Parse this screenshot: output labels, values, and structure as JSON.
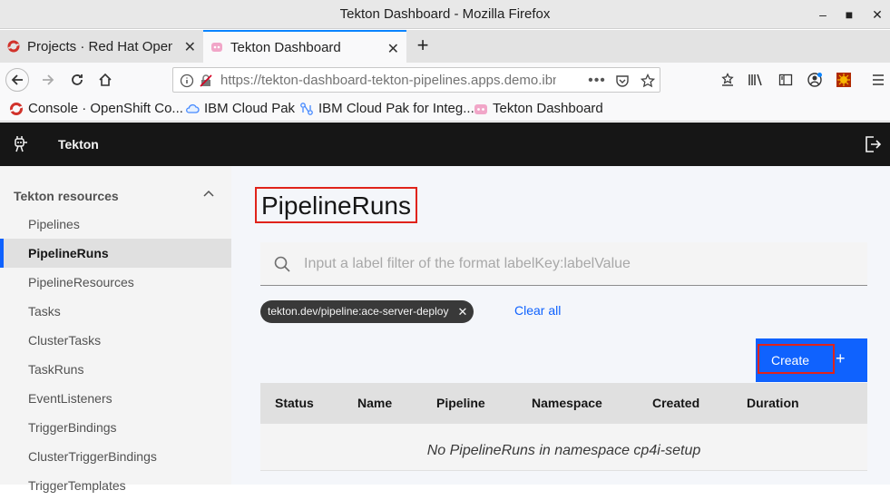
{
  "window": {
    "title": "Tekton Dashboard - Mozilla Firefox"
  },
  "tabs": [
    {
      "label": "Projects · Red Hat OpenS",
      "active": false
    },
    {
      "label": "Tekton Dashboard",
      "active": true
    }
  ],
  "address_bar": {
    "url": "https://tekton-dashboard-tekton-pipelines.apps.demo.ibm"
  },
  "bookmarks": [
    {
      "label": "Console · OpenShift Co..."
    },
    {
      "label": "IBM Cloud Pak"
    },
    {
      "label": "IBM Cloud Pak for Integ..."
    },
    {
      "label": "Tekton Dashboard"
    }
  ],
  "app": {
    "name": "Tekton"
  },
  "sidebar": {
    "section_title": "Tekton resources",
    "items": [
      {
        "label": "Pipelines"
      },
      {
        "label": "PipelineRuns",
        "active": true
      },
      {
        "label": "PipelineResources"
      },
      {
        "label": "Tasks"
      },
      {
        "label": "ClusterTasks"
      },
      {
        "label": "TaskRuns"
      },
      {
        "label": "EventListeners"
      },
      {
        "label": "TriggerBindings"
      },
      {
        "label": "ClusterTriggerBindings"
      },
      {
        "label": "TriggerTemplates"
      }
    ]
  },
  "main": {
    "title": "PipelineRuns",
    "filter_placeholder": "Input a label filter of the format labelKey:labelValue",
    "active_filter": "tekton.dev/pipeline:ace-server-deploy",
    "clear_all": "Clear all",
    "create_label": "Create",
    "table": {
      "columns": [
        "Status",
        "Name",
        "Pipeline",
        "Namespace",
        "Created",
        "Duration"
      ],
      "empty_message": "No PipelineRuns in namespace cp4i-setup"
    }
  },
  "colors": {
    "accent": "#0f62fe",
    "highlight_box": "#e0231a",
    "header_bg": "#161616"
  }
}
